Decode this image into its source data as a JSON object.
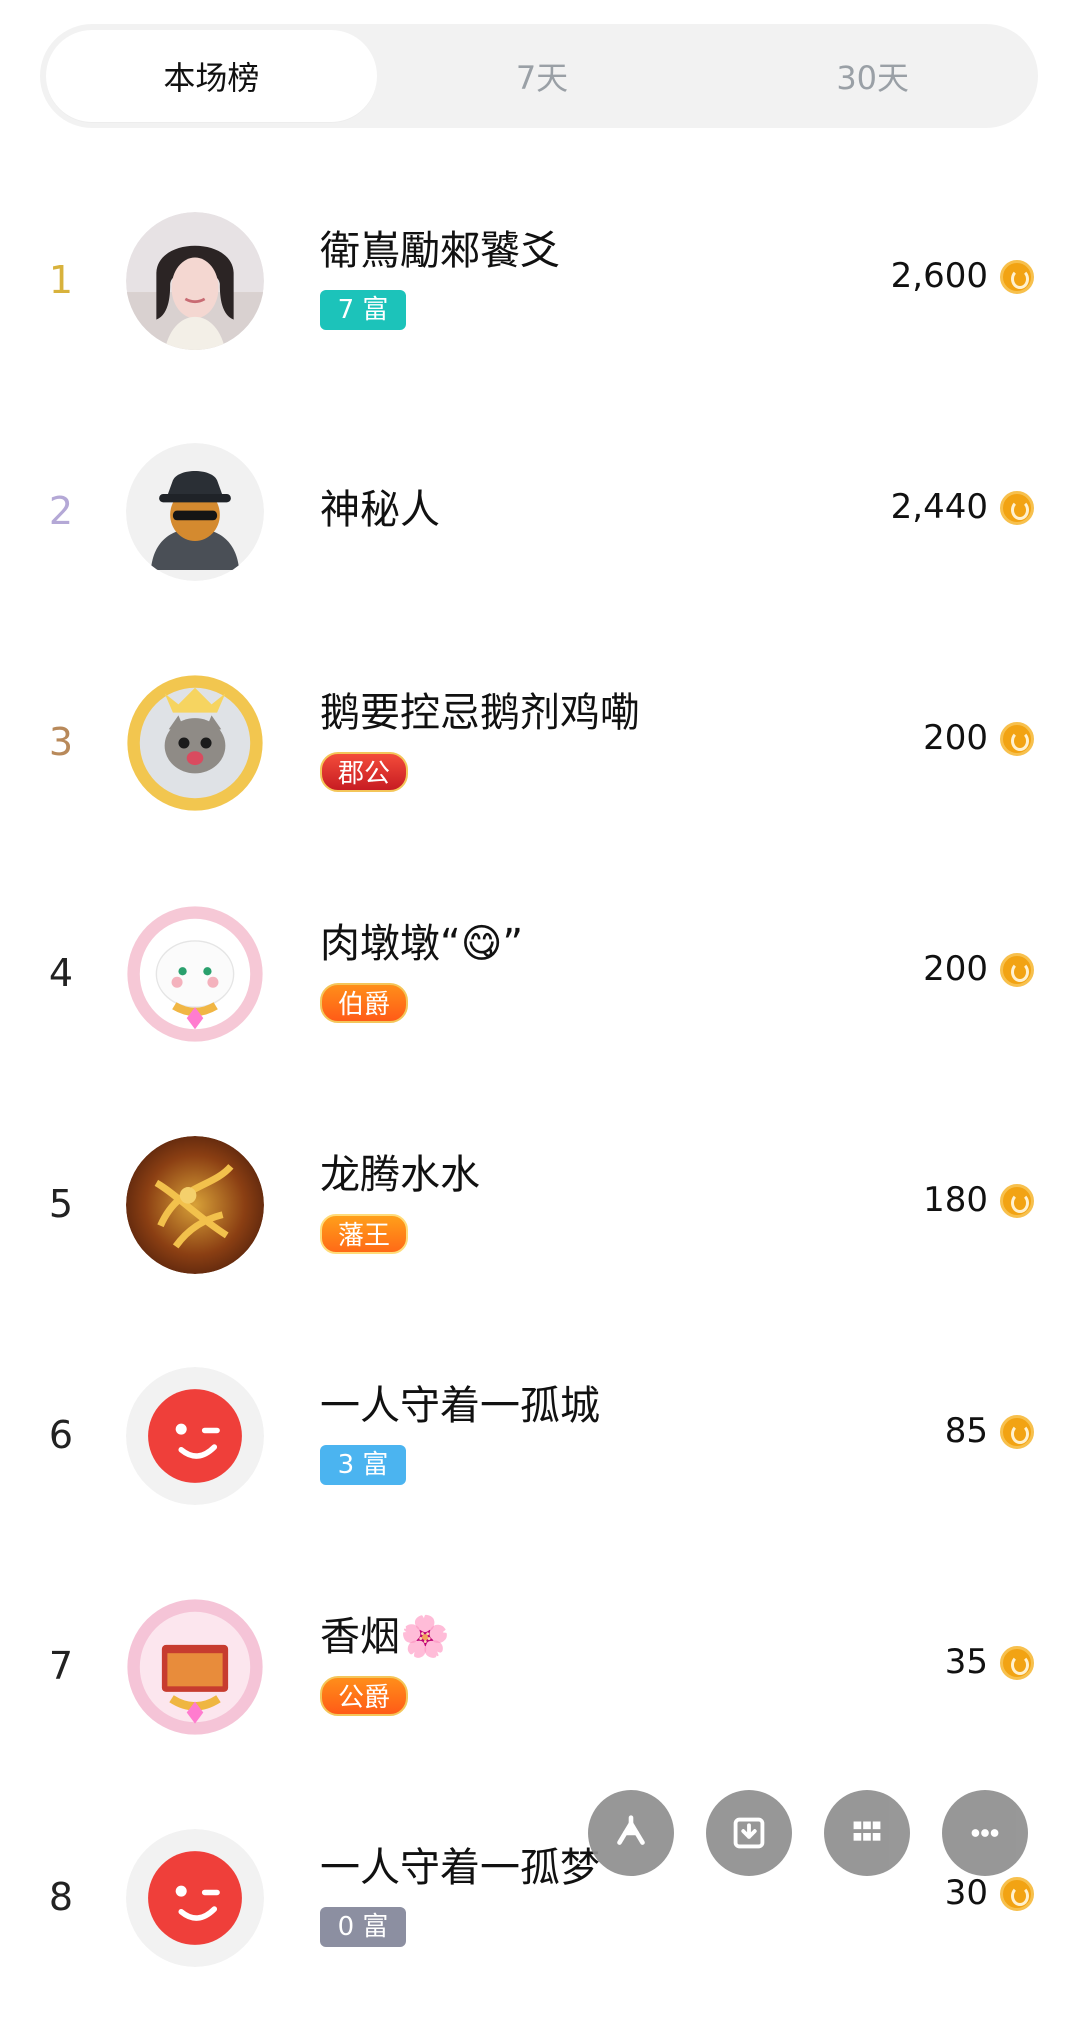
{
  "tabs": [
    {
      "label": "本场榜",
      "active": true
    },
    {
      "label": "7天",
      "active": false
    },
    {
      "label": "30天",
      "active": false
    }
  ],
  "rows": [
    {
      "rank": "1",
      "name": "衛嶌勵郲饕爻",
      "score": "2,600",
      "badge": "7 富",
      "badge_color": "teal",
      "rank_color": "gold"
    },
    {
      "rank": "2",
      "name": "神秘人",
      "score": "2,440",
      "badge": "",
      "badge_color": "",
      "rank_color": "silver"
    },
    {
      "rank": "3",
      "name": "鹅要控忌鹅剂鸡嘞",
      "score": "200",
      "badge": "郡公",
      "badge_color": "red",
      "rank_color": "bronze"
    },
    {
      "rank": "4",
      "name": "肉墩墩“😋”",
      "score": "200",
      "badge": "伯爵",
      "badge_color": "orange",
      "rank_color": ""
    },
    {
      "rank": "5",
      "name": "龙腾水水",
      "score": "180",
      "badge": "藩王",
      "badge_color": "gold",
      "rank_color": ""
    },
    {
      "rank": "6",
      "name": "一人守着一孤城",
      "score": "85",
      "badge": "3 富",
      "badge_color": "blue",
      "rank_color": ""
    },
    {
      "rank": "7",
      "name": "香烟🌸",
      "score": "35",
      "badge": "公爵",
      "badge_color": "orange",
      "rank_color": ""
    },
    {
      "rank": "8",
      "name": "一人守着一孤梦",
      "score": "30",
      "badge": "0 富",
      "badge_color": "gray",
      "rank_color": ""
    }
  ],
  "icons": {
    "coin": "coin-icon",
    "fab": [
      "share-icon",
      "download-icon",
      "grid-icon",
      "more-icon"
    ]
  }
}
